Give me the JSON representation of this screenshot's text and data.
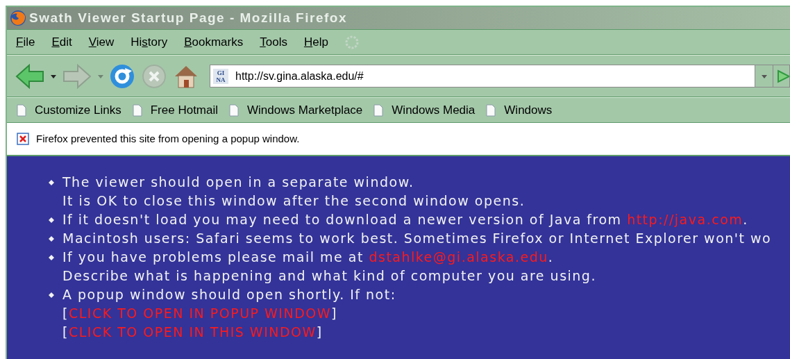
{
  "window": {
    "title": "Swath Viewer Startup Page - Mozilla Firefox"
  },
  "menu": [
    {
      "key": "F",
      "after": "ile"
    },
    {
      "key": "E",
      "after": "dit"
    },
    {
      "key": "V",
      "after": "iew"
    },
    {
      "before": "Hi",
      "key": "s",
      "after": "tory"
    },
    {
      "key": "B",
      "after": "ookmarks"
    },
    {
      "key": "T",
      "after": "ools"
    },
    {
      "key": "H",
      "after": "elp"
    }
  ],
  "navigation": {
    "back": {
      "disabled": false
    },
    "forward": {
      "disabled": true
    },
    "stop": {
      "disabled": true
    }
  },
  "address_bar": {
    "favicon": [
      "GI",
      "NA"
    ],
    "value": "http://sv.gina.alaska.edu/#"
  },
  "bookmarks": [
    {
      "label": "Customize Links"
    },
    {
      "label": "Free Hotmail"
    },
    {
      "label": "Windows Marketplace"
    },
    {
      "label": "Windows Media"
    },
    {
      "label": "Windows"
    }
  ],
  "notification": {
    "text": "Firefox prevented this site from opening a popup window."
  },
  "content": {
    "items": [
      {
        "lines": [
          [
            {
              "kind": "text",
              "text": "The viewer should open in a separate window."
            }
          ],
          [
            {
              "kind": "text",
              "text": "It is OK to close this window after the second window opens."
            }
          ]
        ]
      },
      {
        "lines": [
          [
            {
              "kind": "text",
              "text": "If it doesn't load you may need to download a newer version of Java from "
            },
            {
              "kind": "link",
              "text": "http://java.com"
            },
            {
              "kind": "text",
              "text": "."
            }
          ]
        ]
      },
      {
        "lines": [
          [
            {
              "kind": "text",
              "text": "Macintosh users: Safari seems to work best. Sometimes Firefox or Internet Explorer won't wo"
            }
          ]
        ]
      },
      {
        "lines": [
          [
            {
              "kind": "text",
              "text": "If you have problems please mail me at "
            },
            {
              "kind": "link",
              "text": "dstahlke@gi.alaska.edu"
            },
            {
              "kind": "text",
              "text": "."
            }
          ],
          [
            {
              "kind": "text",
              "text": "Describe what is happening and what kind of computer you are using."
            }
          ]
        ]
      },
      {
        "lines": [
          [
            {
              "kind": "text",
              "text": "A popup window should open shortly. If not:"
            }
          ],
          [
            {
              "kind": "text",
              "text": "["
            },
            {
              "kind": "link",
              "text": "CLICK TO OPEN IN POPUP WINDOW"
            },
            {
              "kind": "text",
              "text": "]"
            }
          ],
          [
            {
              "kind": "text",
              "text": "["
            },
            {
              "kind": "link",
              "text": "CLICK TO OPEN IN THIS WINDOW"
            },
            {
              "kind": "text",
              "text": "]"
            }
          ]
        ]
      }
    ]
  }
}
